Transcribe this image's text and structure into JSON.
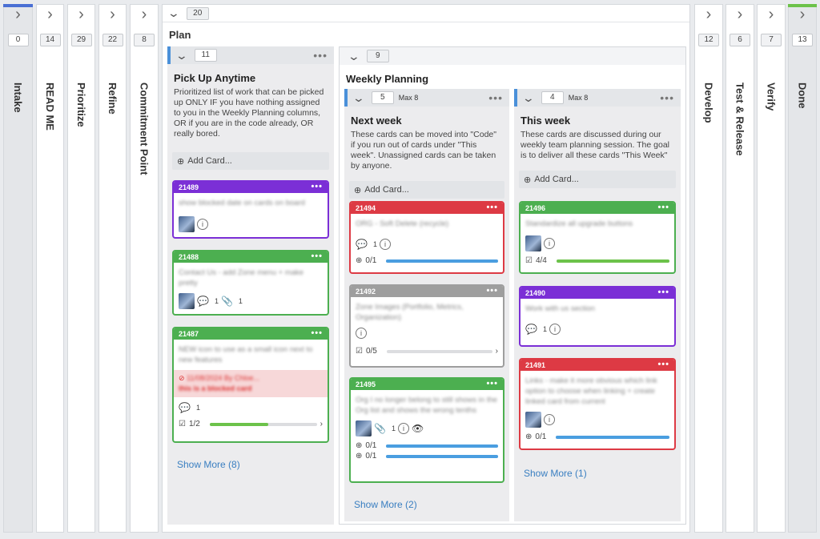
{
  "collapsed_left": [
    {
      "name": "Intake",
      "count": "0",
      "accent": "#4a6fd4"
    },
    {
      "name": "READ ME",
      "count": "14"
    },
    {
      "name": "Prioritize",
      "count": "29"
    },
    {
      "name": "Refine",
      "count": "22"
    },
    {
      "name": "Commitment Point",
      "count": "8"
    }
  ],
  "collapsed_right": [
    {
      "name": "Develop",
      "count": "12"
    },
    {
      "name": "Test & Release",
      "count": "6"
    },
    {
      "name": "Verify",
      "count": "7"
    },
    {
      "name": "Done",
      "count": "13",
      "accent": "#6cc24a"
    }
  ],
  "plan": {
    "title": "Plan",
    "count": "20"
  },
  "pick_up": {
    "count": "11",
    "title": "Pick Up Anytime",
    "desc": "Prioritized list of work that can be picked up ONLY IF you have nothing assigned to you in the Weekly Planning columns, OR if you are in the code already, OR really bored.",
    "add": "Add Card...",
    "show_more": "Show More (8)"
  },
  "weekly": {
    "count": "9",
    "title": "Weekly Planning"
  },
  "next_week": {
    "count": "5",
    "limit": "Max 8",
    "title": "Next week",
    "desc": "These cards can be moved into \"Code\" if you run out of cards under \"This week\". Unassigned cards can be taken by anyone.",
    "add": "Add Card...",
    "show_more": "Show More (2)"
  },
  "this_week": {
    "count": "4",
    "limit": "Max 8",
    "title": "This week",
    "desc": "These cards are discussed during our weekly team planning session. The goal is to deliver all these cards \"This Week\"",
    "add": "Add Card...",
    "show_more": "Show More (1)"
  },
  "cards": {
    "c21489": {
      "id": "21489",
      "color": "#7b2fd6",
      "text": "show blocked date on cards on board"
    },
    "c21488": {
      "id": "21488",
      "color": "#4caf50",
      "text": "Contact Us - add Zone menu + make pretty",
      "c1": "1",
      "c2": "1"
    },
    "c21487": {
      "id": "21487",
      "color": "#4caf50",
      "text": "NEW icon to use as a small icon next to new features",
      "blocked_by": "11/08/2024 By Chloe...",
      "blocked_text": "this is a blocked card",
      "c1": "1",
      "prog": "1/2",
      "frac": 0.55
    },
    "c21494": {
      "id": "21494",
      "color": "#dd3a44",
      "text": "ORG - Soft Delete (recycle)",
      "c1": "1",
      "prog": "0/1",
      "frac": 1.0
    },
    "c21492": {
      "id": "21492",
      "color": "#9e9e9e",
      "text": "Zone Images (Portfolio, Metrics, Organization)",
      "prog": "0/5",
      "frac": 0.0
    },
    "c21495": {
      "id": "21495",
      "color": "#4caf50",
      "text": "Org I no longer belong to still shows in the Org list and shows the wrong tenths",
      "c1": "1",
      "prog1": "0/1",
      "prog2": "0/1",
      "frac": 1.0
    },
    "c21496": {
      "id": "21496",
      "color": "#4caf50",
      "text": "Standardize all upgrade buttons",
      "prog": "4/4",
      "frac": 1.0
    },
    "c21490": {
      "id": "21490",
      "color": "#7b2fd6",
      "text": "Work with us section",
      "c1": "1"
    },
    "c21491": {
      "id": "21491",
      "color": "#dd3a44",
      "text": "Links - make it more obvious which link option to choose when linking + create linked card from current",
      "prog": "0/1",
      "frac": 1.0
    }
  }
}
